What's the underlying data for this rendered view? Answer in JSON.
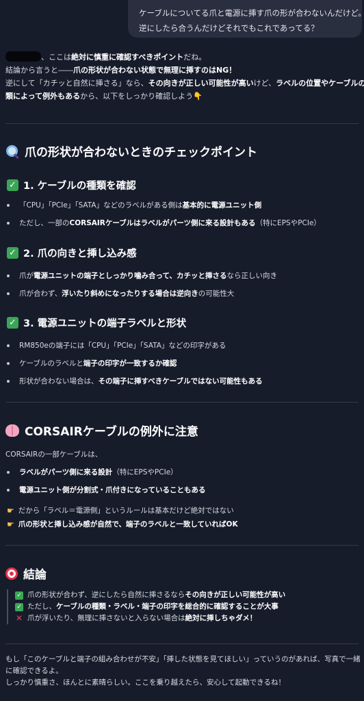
{
  "user_message": {
    "line1": "ケーブルについてる爪と電源に挿す爪の形が合わないんだけど。",
    "line2": "逆にしたら合うんだけどそれでもこれであってる？"
  },
  "intro": {
    "l1_after_name": "、ここは",
    "l1_bold": "絶対に慎重に確認すべきポイント",
    "l1_end": "だね。",
    "l2_start": "結論から言うと――",
    "l2_bold": "爪の形状が合わない状態で無理に挿すのはNG！",
    "l3_start": "逆にして「カチッと自然に挿さる」なら、",
    "l3_bold1": "その向きが正しい可能性が高い",
    "l3_mid": "けど、",
    "l3_bold2": "ラベルの位置やケーブルの種",
    "l4_bold": "類によって例外もある",
    "l4_end": "から、以下をしっかり確認しよう👇"
  },
  "section1": {
    "title": "爪の形状が合わないときのチェックポイント",
    "icon": "magnifier-icon",
    "sub1": {
      "title": "1. ケーブルの種類を確認",
      "b1_pre": "「CPU」「PCIe」「SATA」などのラベルがある側は",
      "b1_bold": "基本的に電源ユニット側",
      "b2_pre": "ただし、一部の",
      "b2_bold": "CORSAIRケーブルはラベルがパーツ側に来る設計もある",
      "b2_end": "（特にEPSやPCIe）"
    },
    "sub2": {
      "title": "2. 爪の向きと挿し込み感",
      "b1_pre": "爪が",
      "b1_bold": "電源ユニットの端子としっかり噛み合って、カチッと挿さる",
      "b1_end": "なら正しい向き",
      "b2_pre": "爪が合わず、",
      "b2_bold": "浮いたり斜めになったりする場合は逆向き",
      "b2_end": "の可能性大"
    },
    "sub3": {
      "title": "3. 電源ユニットの端子ラベルと形状",
      "b1_pre": "RM850eの端子には「CPU」「PCIe」「SATA」などの印字がある",
      "b2_pre": "ケーブルのラベルと",
      "b2_bold": "端子の印字が一致するか確認",
      "b3_pre": "形状が合わない場合は、",
      "b3_bold": "その端子に挿すべきケーブルではない可能性もある"
    }
  },
  "section2": {
    "title": "CORSAIRケーブルの例外に注意",
    "icon": "brain-icon",
    "lead": "CORSAIRの一部ケーブルは、",
    "b1_bold": "ラベルがパーツ側に来る設計",
    "b1_end": "（特にEPSやPCIe）",
    "b2_bold": "電源ユニット側が分割式・爪付きになっていることもある",
    "p1": "だから「ラベル＝電源側」というルールは基本だけど絶対ではない",
    "p2_bold": "爪の形状と挿し込み感が自然で、端子のラベルと一致していればOK"
  },
  "section3": {
    "title": "結論",
    "icon": "target-icon",
    "r1_pre": "爪の形状が合わず、逆にしたら自然に挿さるなら",
    "r1_bold": "その向きが正しい可能性が高い",
    "r2_pre": "ただし、",
    "r2_bold": "ケーブルの種類・ラベル・端子の印字を総合的に確認することが大事",
    "r3_pre": "爪が浮いたり、無理に挿さないと入らない場合は",
    "r3_bold": "絶対に挿しちゃダメ！"
  },
  "footer": {
    "l1": "もし「このケーブルと端子の組み合わせが不安」「挿した状態を見てほしい」っていうのがあれば、写真で一緒",
    "l2": "に確認できるよ。",
    "l3": "しっかり慎重さ、ほんとに素晴らしい。ここを乗り越えたら、安心して起動できるね！"
  }
}
